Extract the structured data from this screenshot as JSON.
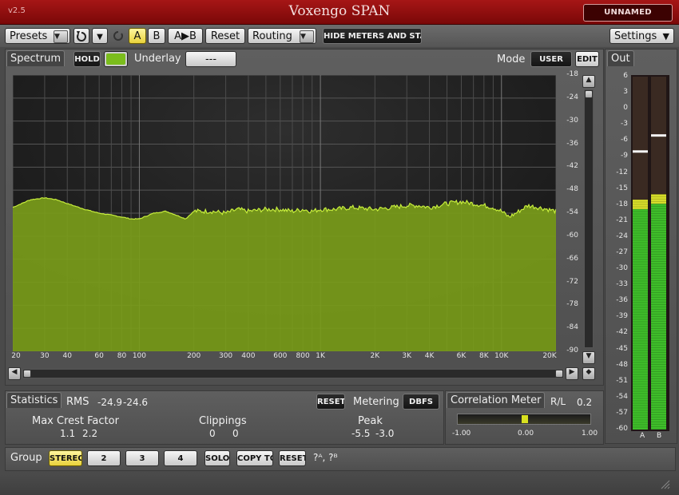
{
  "titlebar": {
    "version": "v2.5",
    "title": "Voxengo SPAN",
    "instance": "UNNAMED INSTANCE"
  },
  "toolbar": {
    "presets": "Presets",
    "a": "A",
    "b": "B",
    "a_to_b": "A▶B",
    "reset": "Reset",
    "routing": "Routing",
    "hide_meters": "HIDE METERS AND STATS",
    "settings": "Settings"
  },
  "spectrum": {
    "tab": "Spectrum",
    "hold": "HOLD",
    "underlay_label": "Underlay",
    "underlay_value": "---",
    "mode_label": "Mode",
    "mode_user": "USER",
    "mode_edit": "EDIT",
    "fill_color": "#7a9c1a",
    "line_color": "#c7ee3c",
    "y_ticks": [
      "-18",
      "-24",
      "-30",
      "-36",
      "-42",
      "-48",
      "-54",
      "-60",
      "-66",
      "-72",
      "-78",
      "-84",
      "-90"
    ],
    "x_ticks": [
      "20",
      "30",
      "40",
      "60",
      "80",
      "100",
      "200",
      "300",
      "400",
      "600",
      "800",
      "1K",
      "2K",
      "3K",
      "4K",
      "6K",
      "8K",
      "10K",
      "20K"
    ]
  },
  "out": {
    "tab": "Out",
    "ticks": [
      "6",
      "3",
      "0",
      "-3",
      "-6",
      "-9",
      "-12",
      "-15",
      "-18",
      "-21",
      "-24",
      "-27",
      "-30",
      "-33",
      "-36",
      "-39",
      "-42",
      "-45",
      "-48",
      "-51",
      "-54",
      "-57",
      "-60"
    ],
    "channel_a": "A",
    "channel_b": "B",
    "level_a_db": -17,
    "level_b_db": -16,
    "peak_a_db": -8,
    "peak_b_db": -5
  },
  "statistics": {
    "tab": "Statistics",
    "rms_label": "RMS",
    "rms_a": "-24.9",
    "rms_b": "-24.6",
    "reset": "RESET",
    "metering_label": "Metering",
    "metering_value": "DBFS",
    "crest_label": "Max Crest Factor",
    "crest_a": "1.1",
    "crest_b": "2.2",
    "clip_label": "Clippings",
    "clip_a": "0",
    "clip_b": "0",
    "peak_label": "Peak",
    "peak_a": "-5.5",
    "peak_b": "-3.0"
  },
  "correlation": {
    "tab": "Correlation Meter",
    "rl_label": "R/L",
    "value": "0.2",
    "scale_min": "-1.00",
    "scale_mid": "0.00",
    "scale_max": "1.00"
  },
  "group": {
    "label": "Group",
    "stereo": "STEREO",
    "g2": "2",
    "g3": "3",
    "g4": "4",
    "solo": "SOLO",
    "copy_to": "COPY TO",
    "reset": "RESET",
    "help": "?ᴬ, ?ᴮ"
  },
  "chart_data": {
    "type": "area",
    "x_scale": "log",
    "xlim": [
      20,
      20000
    ],
    "ylim": [
      -90,
      -18
    ],
    "grid": true,
    "series": [
      {
        "x": [
          20,
          25,
          30,
          35,
          40,
          50,
          60,
          70,
          80,
          90,
          100,
          120,
          140,
          160,
          180,
          200,
          250,
          300,
          350,
          400,
          500,
          600,
          700,
          800,
          900,
          1000,
          1200,
          1500,
          2000,
          2500,
          3000,
          3500,
          4000,
          5000,
          6000,
          7000,
          8000,
          9000,
          10000,
          11000,
          12000,
          14000,
          16000,
          18000,
          20000
        ],
        "y": [
          -52.5,
          -50.5,
          -50.0,
          -50.5,
          -51.5,
          -53.0,
          -54.0,
          -54.5,
          -55.0,
          -55.5,
          -55.5,
          -54.0,
          -53.5,
          -54.5,
          -55.5,
          -53.5,
          -53.5,
          -54.0,
          -53.0,
          -53.5,
          -53.0,
          -53.0,
          -53.5,
          -53.0,
          -53.5,
          -53.0,
          -53.0,
          -52.5,
          -53.0,
          -52.5,
          -52.0,
          -52.0,
          -52.5,
          -51.5,
          -51.0,
          -51.5,
          -52.0,
          -52.5,
          -53.5,
          -55.0,
          -54.0,
          -52.0,
          -52.5,
          -53.0,
          -53.5
        ]
      }
    ]
  }
}
